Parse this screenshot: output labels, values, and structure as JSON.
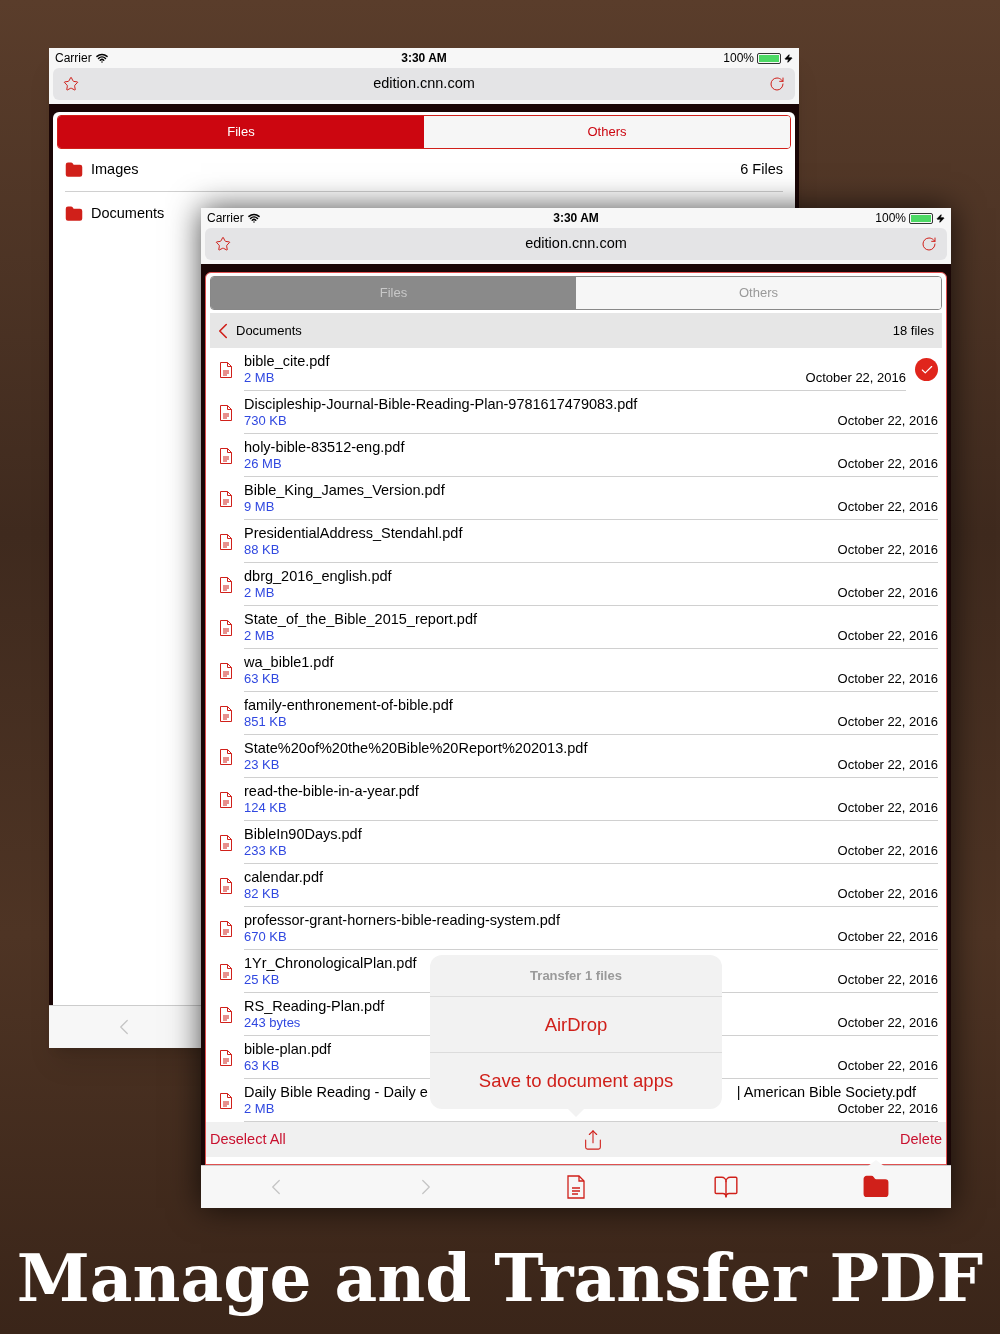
{
  "back_window": {
    "status_bar": {
      "carrier": "Carrier",
      "time": "3:30 AM",
      "battery": "100%"
    },
    "address": "edition.cnn.com",
    "tabs_dimmed": false,
    "tabs": [
      {
        "label": "Files",
        "selected": true
      },
      {
        "label": "Others",
        "selected": false
      }
    ],
    "folders": [
      {
        "name": "Images",
        "count": "6 Files"
      },
      {
        "name": "Documents"
      }
    ],
    "toolbar": [
      {
        "kind": "back",
        "disabled": true,
        "selected": false
      }
    ]
  },
  "front_window": {
    "status_bar": {
      "carrier": "Carrier",
      "time": "3:30 AM",
      "battery": "100%"
    },
    "address": "edition.cnn.com",
    "tabs_dimmed": true,
    "tabs": [
      {
        "label": "Files",
        "selected": true
      },
      {
        "label": "Others",
        "selected": false
      }
    ],
    "folder_header": {
      "title": "Documents",
      "count": "18 files"
    },
    "files": [
      {
        "name": "bible_cite.pdf",
        "size": "2 MB",
        "date": "October 22, 2016",
        "selected": true
      },
      {
        "name": "Discipleship-Journal-Bible-Reading-Plan-9781617479083.pdf",
        "size": "730 KB",
        "date": "October 22, 2016",
        "selected": false
      },
      {
        "name": "holy-bible-83512-eng.pdf",
        "size": "26 MB",
        "date": "October 22, 2016",
        "selected": false
      },
      {
        "name": "Bible_King_James_Version.pdf",
        "size": "9 MB",
        "date": "October 22, 2016",
        "selected": false
      },
      {
        "name": "PresidentialAddress_Stendahl.pdf",
        "size": "88 KB",
        "date": "October 22, 2016",
        "selected": false
      },
      {
        "name": "dbrg_2016_english.pdf",
        "size": "2 MB",
        "date": "October 22, 2016",
        "selected": false
      },
      {
        "name": "State_of_the_Bible_2015_report.pdf",
        "size": "2 MB",
        "date": "October 22, 2016",
        "selected": false
      },
      {
        "name": "wa_bible1.pdf",
        "size": "63 KB",
        "date": "October 22, 2016",
        "selected": false
      },
      {
        "name": "family-enthronement-of-bible.pdf",
        "size": "851 KB",
        "date": "October 22, 2016",
        "selected": false
      },
      {
        "name": "State%20of%20the%20Bible%20Report%202013.pdf",
        "size": "23 KB",
        "date": "October 22, 2016",
        "selected": false
      },
      {
        "name": "read-the-bible-in-a-year.pdf",
        "size": "124 KB",
        "date": "October 22, 2016",
        "selected": false
      },
      {
        "name": "BibleIn90Days.pdf",
        "size": "233 KB",
        "date": "October 22, 2016",
        "selected": false
      },
      {
        "name": "calendar.pdf",
        "size": "82 KB",
        "date": "October 22, 2016",
        "selected": false
      },
      {
        "name": "professor-grant-horners-bible-reading-system.pdf",
        "size": "670 KB",
        "date": "October 22, 2016",
        "selected": false
      },
      {
        "name": "1Yr_ChronologicalPlan.pdf",
        "size": "25 KB",
        "date": "October 22, 2016",
        "selected": false
      },
      {
        "name": "RS_Reading-Plan.pdf",
        "size": "243 bytes",
        "date": "October 22, 2016",
        "selected": false
      },
      {
        "name": "bible-plan.pdf",
        "size": "63 KB",
        "date": "October 22, 2016",
        "selected": false
      },
      {
        "name": "Daily Bible Reading - Daily e",
        "name_tail": "| American Bible Society.pdf",
        "size": "2 MB",
        "date": "October 22, 2016",
        "selected": false
      }
    ],
    "popover": {
      "title": "Transfer 1 files",
      "actions": [
        "AirDrop",
        "Save to document apps"
      ]
    },
    "action_bar": {
      "left": "Deselect All",
      "right": "Delete"
    },
    "toolbar": [
      {
        "kind": "back",
        "disabled": true,
        "selected": false
      },
      {
        "kind": "forward",
        "disabled": true,
        "selected": false
      },
      {
        "kind": "pdf",
        "disabled": false,
        "selected": false
      },
      {
        "kind": "book",
        "disabled": false,
        "selected": false
      },
      {
        "kind": "folder",
        "disabled": false,
        "selected": true
      }
    ]
  },
  "caption": "Manage and Transfer PDF"
}
